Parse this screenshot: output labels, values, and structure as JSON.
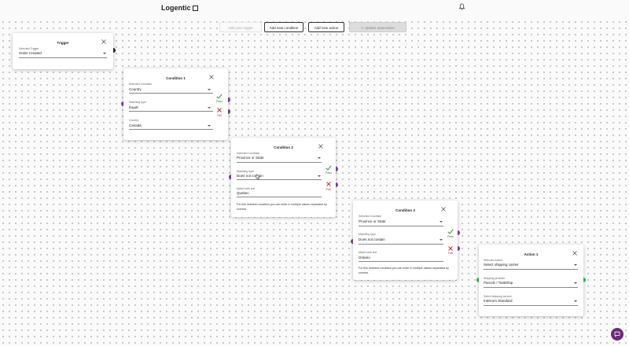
{
  "header": {
    "brand": "Logentic"
  },
  "toolbar": {
    "add_trigger": "Add your trigger",
    "add_condition": "Add new condition",
    "add_action": "Add new action",
    "update": "Update automation"
  },
  "trigger": {
    "title": "Trigger",
    "field_label": "Selected Trigger",
    "field_value": "Order Created"
  },
  "condition1": {
    "title": "Condition 1",
    "f1_label": "Selected Condition",
    "f1_value": "Country",
    "f2_label": "Matching type",
    "f2_value": "Equal",
    "f3_label": "Country",
    "f3_value": "Canada",
    "pass": "Pass",
    "fail": "Fail"
  },
  "condition2": {
    "title": "Condition 2",
    "f1_label": "Selected Condition",
    "f1_value": "Province or State",
    "f2_label": "Matching type",
    "f2_value": "Does not contain",
    "f3_label": "Match with text",
    "f3_value": "Quebec",
    "help": "For this selected condition you can enter in multiple values separated by comma.",
    "pass": "Pass",
    "fail": "Fail"
  },
  "condition3": {
    "title": "Condition 3",
    "f1_label": "Selected Condition",
    "f1_value": "Province or State",
    "f2_label": "Matching type",
    "f2_value": "Does not contain",
    "f3_label": "Match with text",
    "f3_value": "Ontario",
    "help": "For this selected condition you can enter in multiple values separated by comma.",
    "pass": "Pass",
    "fail": "Fail"
  },
  "action1": {
    "title": "Action 1",
    "f1_label": "Selected Action",
    "f1_value": "Select shipping carrier",
    "f2_label": "Shipping provider",
    "f2_value": "Parcelz / TotalShip",
    "f3_label": "Select shipping service",
    "f3_value": "Intelcom Standard"
  },
  "colors": {
    "accent": "#7b3a8e",
    "pass": "#2e7d32",
    "fail": "#c62828",
    "node_green": "#27ae60"
  }
}
